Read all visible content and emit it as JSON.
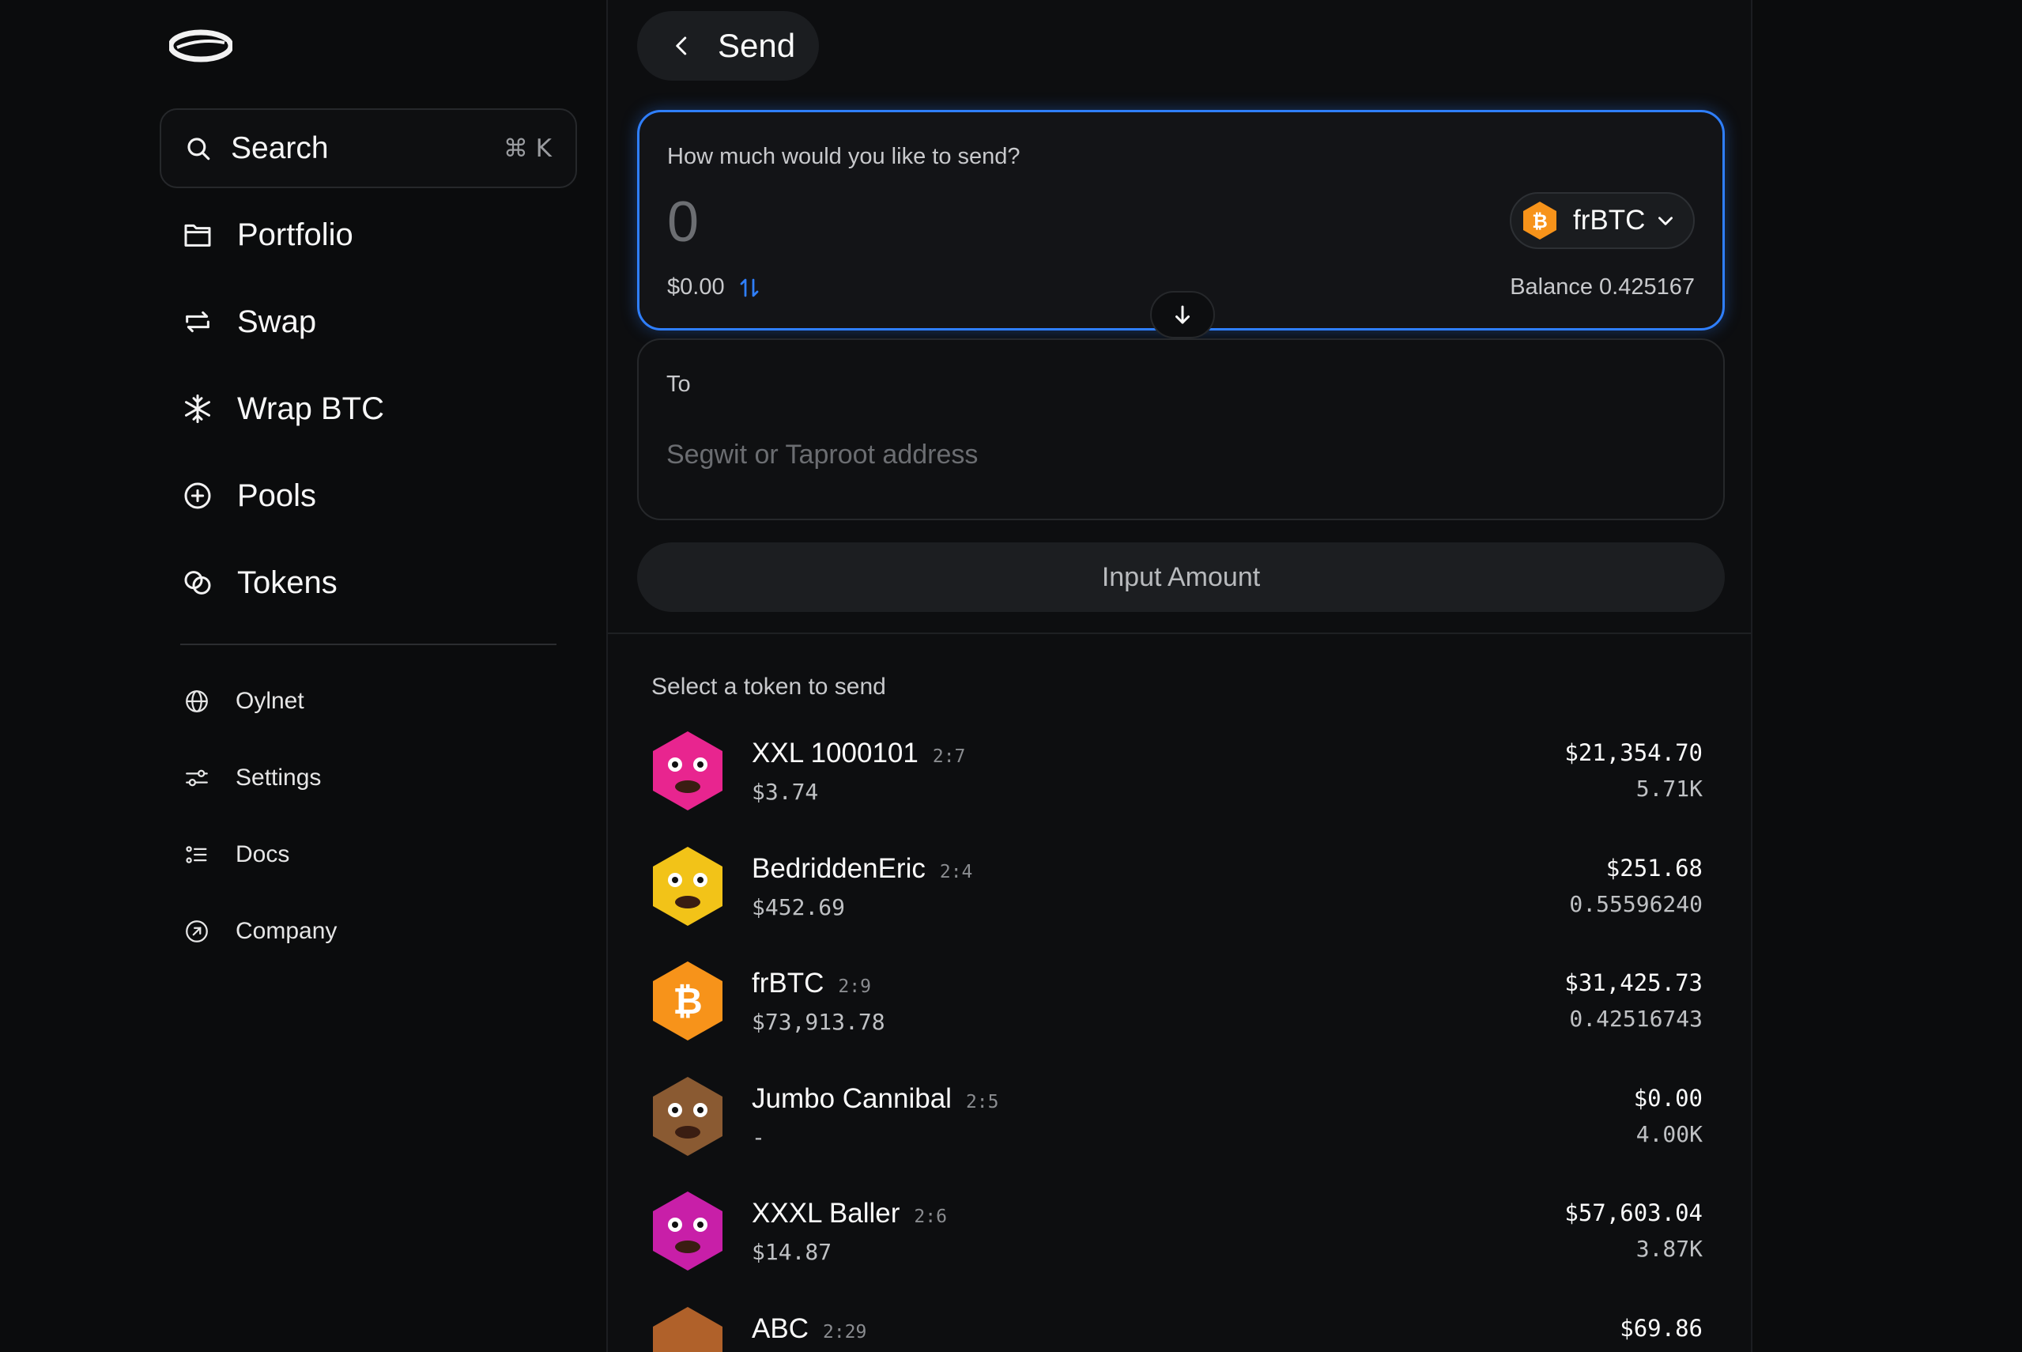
{
  "sidebar": {
    "search": {
      "label": "Search",
      "shortcut": "⌘ K"
    },
    "main_items": [
      {
        "label": "Portfolio",
        "icon": "portfolio-icon"
      },
      {
        "label": "Swap",
        "icon": "swap-icon"
      },
      {
        "label": "Wrap BTC",
        "icon": "snowflake-icon"
      },
      {
        "label": "Pools",
        "icon": "plus-circle-icon"
      },
      {
        "label": "Tokens",
        "icon": "coins-icon"
      }
    ],
    "secondary_items": [
      {
        "label": "Oylnet",
        "icon": "globe-icon"
      },
      {
        "label": "Settings",
        "icon": "sliders-icon"
      },
      {
        "label": "Docs",
        "icon": "list-icon"
      },
      {
        "label": "Company",
        "icon": "arrow-circle-icon"
      }
    ]
  },
  "send": {
    "back_label": "Send",
    "amount_question": "How much would you like to send?",
    "amount_value": "0",
    "amount_usd": "$0.00",
    "token_symbol": "frBTC",
    "balance": "Balance 0.425167",
    "to_label": "To",
    "address_placeholder": "Segwit or Taproot address",
    "submit_label": "Input Amount"
  },
  "token_list": {
    "title": "Select a token to send",
    "tokens": [
      {
        "name": "XXL 1000101",
        "id": "2:7",
        "price": "$3.74",
        "value": "$21,354.70",
        "amount": "5.71K",
        "color": "#e8258f"
      },
      {
        "name": "BedriddenEric",
        "id": "2:4",
        "price": "$452.69",
        "value": "$251.68",
        "amount": "0.55596240",
        "color": "#f2c318"
      },
      {
        "name": "frBTC",
        "id": "2:9",
        "price": "$73,913.78",
        "value": "$31,425.73",
        "amount": "0.42516743",
        "color": "#f7931a"
      },
      {
        "name": "Jumbo Cannibal",
        "id": "2:5",
        "price": "-",
        "value": "$0.00",
        "amount": "4.00K",
        "color": "#8a5a32"
      },
      {
        "name": "XXXL Baller",
        "id": "2:6",
        "price": "$14.87",
        "value": "$57,603.04",
        "amount": "3.87K",
        "color": "#c81fa8"
      },
      {
        "name": "ABC",
        "id": "2:29",
        "price": "",
        "value": "$69.86",
        "amount": "",
        "color": "#b0612a"
      }
    ]
  },
  "colors": {
    "accent": "#2f7fff",
    "bitcoin": "#f7931a",
    "background": "#0b0c0d"
  }
}
